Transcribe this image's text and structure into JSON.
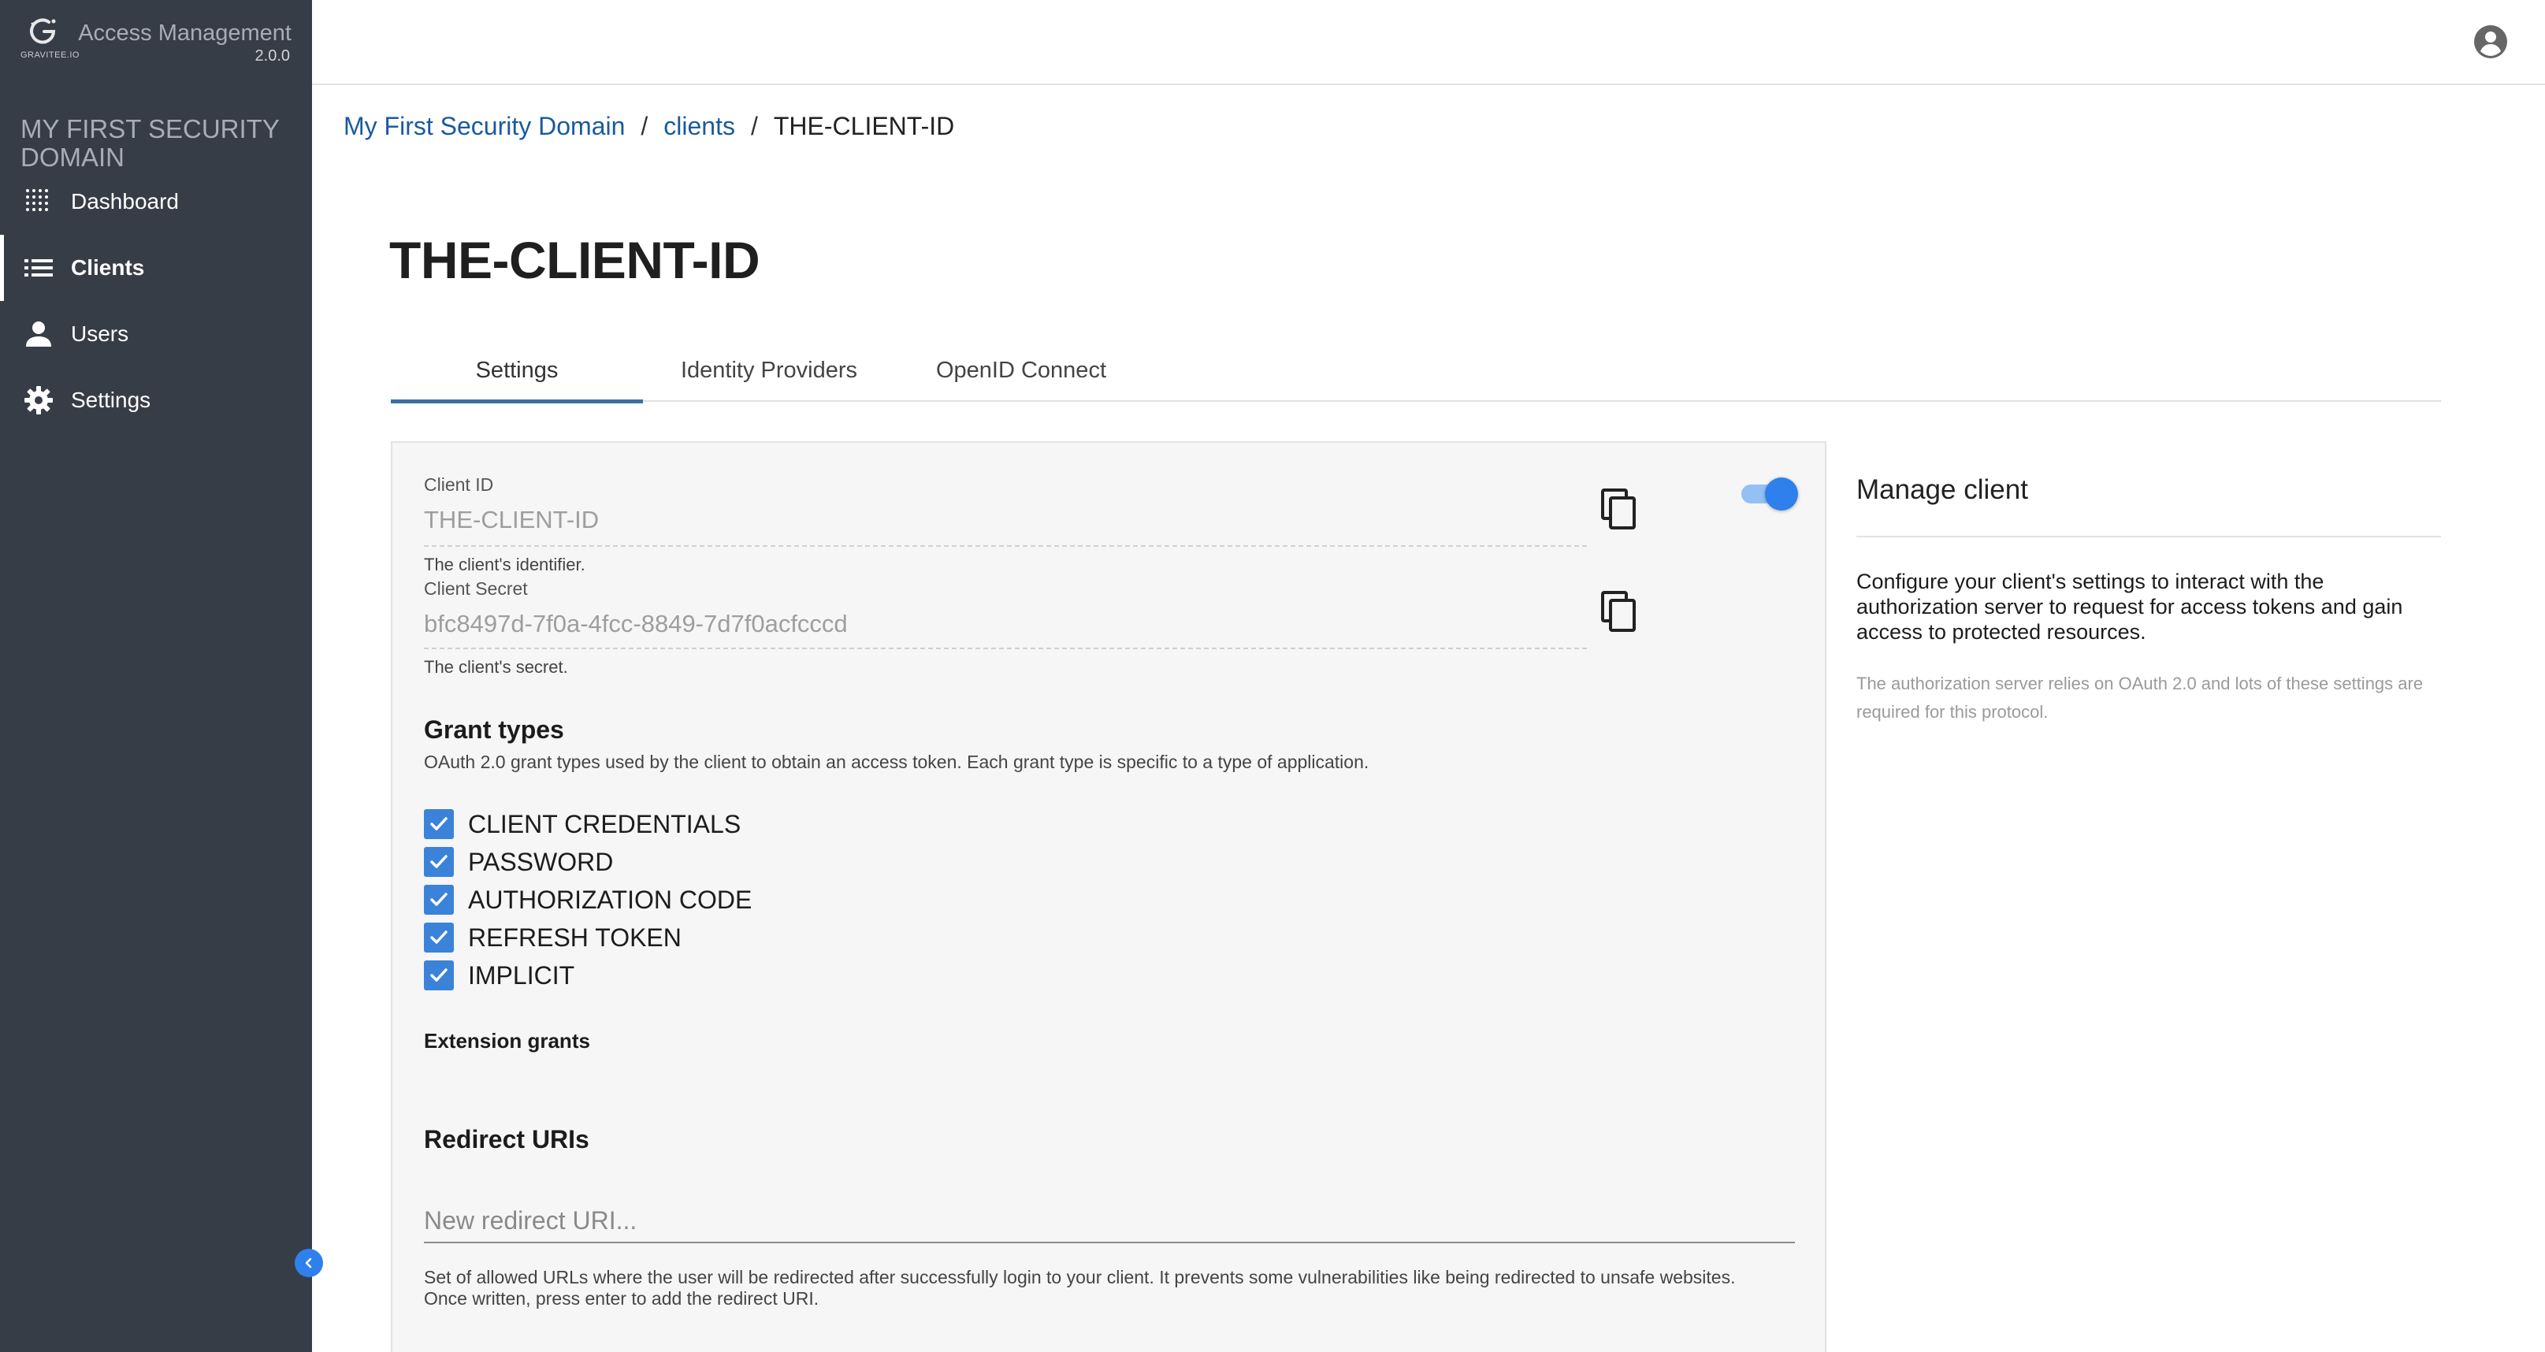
{
  "app": {
    "brand_sub": "GRAVITEE.IO",
    "name": "Access Management",
    "version": "2.0.0"
  },
  "sidebar": {
    "domain_title": "MY FIRST SECURITY DOMAIN",
    "items": [
      {
        "label": "Dashboard",
        "icon": "dashboard-icon",
        "active": false
      },
      {
        "label": "Clients",
        "icon": "list-icon",
        "active": true
      },
      {
        "label": "Users",
        "icon": "person-icon",
        "active": false
      },
      {
        "label": "Settings",
        "icon": "gear-icon",
        "active": false
      }
    ]
  },
  "breadcrumb": {
    "items": [
      "My First Security Domain",
      "clients"
    ],
    "current": "THE-CLIENT-ID",
    "separator": "/"
  },
  "page": {
    "title": "THE-CLIENT-ID"
  },
  "tabs": [
    {
      "label": "Settings",
      "active": true
    },
    {
      "label": "Identity Providers",
      "active": false
    },
    {
      "label": "OpenID Connect",
      "active": false
    }
  ],
  "form": {
    "client_id": {
      "label": "Client ID",
      "value": "THE-CLIENT-ID",
      "hint": "The client's identifier."
    },
    "client_secret": {
      "label": "Client Secret",
      "value": "bfc8497d-7f0a-4fcc-8849-7d7f0acfcccd",
      "hint": "The client's secret."
    },
    "enabled": true,
    "grant_types": {
      "title": "Grant types",
      "description": "OAuth 2.0 grant types used by the client to obtain an access token. Each grant type is specific to a type of application.",
      "options": [
        {
          "label": "CLIENT CREDENTIALS",
          "checked": true
        },
        {
          "label": "PASSWORD",
          "checked": true
        },
        {
          "label": "AUTHORIZATION CODE",
          "checked": true
        },
        {
          "label": "REFRESH TOKEN",
          "checked": true
        },
        {
          "label": "IMPLICIT",
          "checked": true
        }
      ]
    },
    "extension_grants": {
      "title": "Extension grants"
    },
    "redirect_uris": {
      "title": "Redirect URIs",
      "placeholder": "New redirect URI...",
      "hint": "Set of allowed URLs where the user will be redirected after successfully login to your client. It prevents some vulnerabilities like being redirected to unsafe websites. Once written, press enter to add the redirect URI."
    }
  },
  "info": {
    "title": "Manage client",
    "body": "Configure your client's settings to interact with the authorization server to request for access tokens and gain access to protected resources.",
    "note": "The authorization server relies on OAuth 2.0 and lots of these settings are required for this protocol."
  },
  "colors": {
    "sidebar_bg": "#373d47",
    "accent": "#2f80ed",
    "link": "#1a5a9e",
    "checkbox": "#3b82d9"
  }
}
